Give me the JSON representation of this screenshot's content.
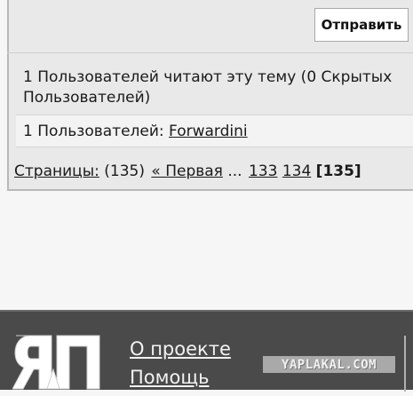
{
  "reply": {
    "send_label": "Отправить"
  },
  "readers": {
    "summary": "1 Пользователей читают эту тему (0 Скрытых Пользователей)",
    "users_prefix": "1 Пользователей:",
    "users": [
      "Forwardini"
    ]
  },
  "pagination": {
    "label": "Страницы:",
    "count": "(135)",
    "first": "« Первая",
    "ellipsis": "...",
    "pages": [
      "133",
      "134"
    ],
    "current": "[135]"
  },
  "footer": {
    "logo_text": "ЯП",
    "about": "О проекте",
    "help": "Помощь",
    "badge": "YAPLAKAL.COM"
  }
}
